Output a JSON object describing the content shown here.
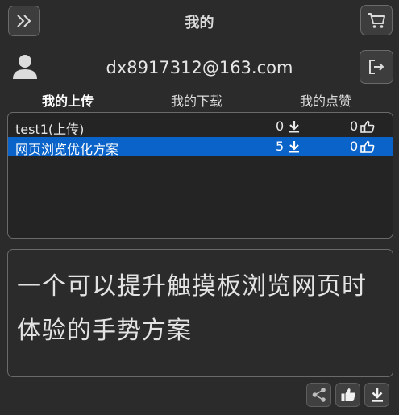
{
  "header": {
    "title": "我的",
    "expand_icon": "double-chevron-right-icon",
    "cart_icon": "shopping-cart-icon"
  },
  "user": {
    "avatar_icon": "user-avatar-icon",
    "email": "dx8917312@163.com",
    "logout_icon": "logout-icon"
  },
  "tabs": [
    {
      "label": "我的上传",
      "active": true
    },
    {
      "label": "我的下载",
      "active": false
    },
    {
      "label": "我的点赞",
      "active": false
    }
  ],
  "list": {
    "rows": [
      {
        "name": "test1(上传)",
        "downloads": "0",
        "likes": "0",
        "selected": false
      },
      {
        "name": "网页浏览优化方案",
        "downloads": "5",
        "likes": "0",
        "selected": true
      }
    ]
  },
  "description": {
    "text": "一个可以提升触摸板浏览网页时体验的手势方案"
  },
  "actions": {
    "share_icon": "share-icon",
    "like_icon": "thumbs-up-icon",
    "download_icon": "download-icon"
  },
  "colors": {
    "background": "#2b2b2b",
    "selection": "#0a63c8"
  }
}
